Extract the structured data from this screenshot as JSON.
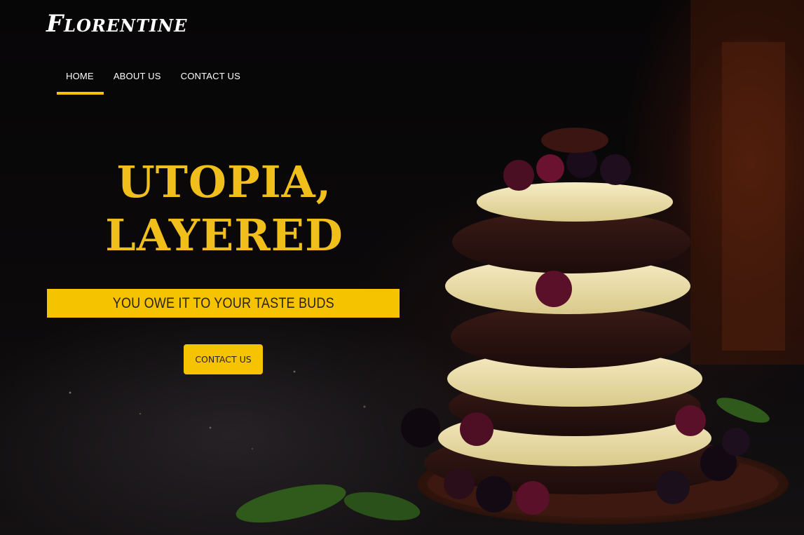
{
  "header": {
    "brand": "Florentine"
  },
  "nav": {
    "items": [
      {
        "label": "HOME",
        "active": true
      },
      {
        "label": "ABOUT US",
        "active": false
      },
      {
        "label": "CONTACT US",
        "active": false
      }
    ]
  },
  "hero": {
    "title_line1": "UTOPIA,",
    "title_line2": "LAYERED",
    "tagline": "YOU OWE IT TO YOUR TASTE BUDS",
    "cta_label": "CONTACT US"
  },
  "colors": {
    "accent": "#f5c300",
    "title": "#f1bf1b",
    "background": "#050405",
    "nav_text": "#ffffff"
  }
}
